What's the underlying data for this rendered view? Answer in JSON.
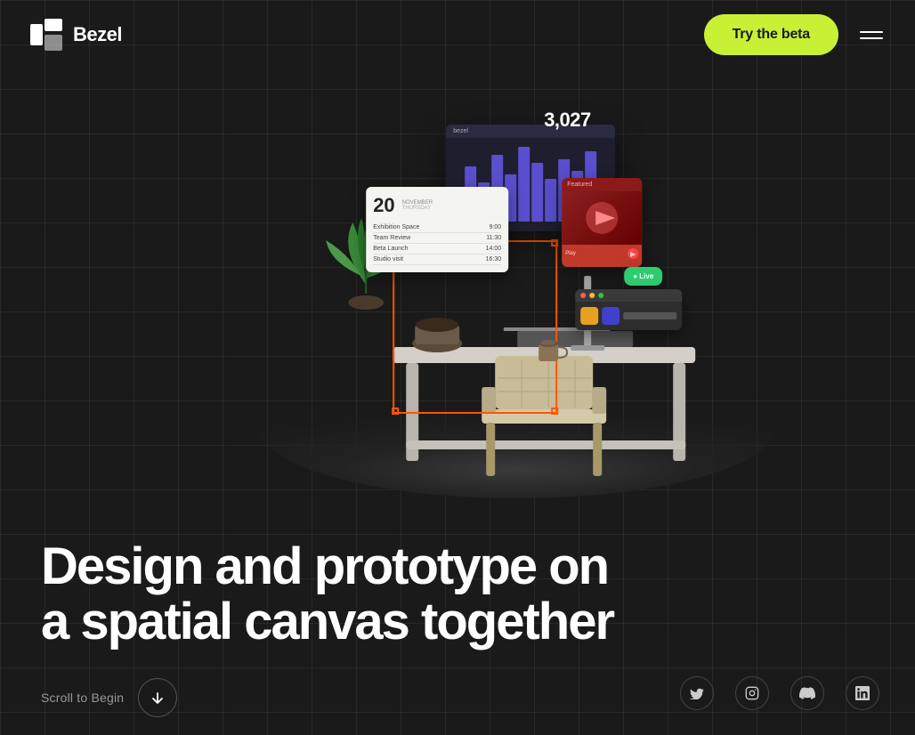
{
  "brand": {
    "name": "Bezel",
    "logo_alt": "Bezel logo"
  },
  "navbar": {
    "try_beta_label": "Try the beta",
    "menu_label": "Menu"
  },
  "hero": {
    "headline_line1": "Design and prototype on",
    "headline_line2": "a spatial canvas together"
  },
  "scroll": {
    "label": "Scroll to Begin"
  },
  "social": {
    "twitter_label": "Twitter",
    "instagram_label": "Instagram",
    "discord_label": "Discord",
    "linkedin_label": "LinkedIn"
  },
  "scene": {
    "stats_number": "3,027",
    "list_date": "20",
    "list_month": "NOVEMBER"
  },
  "colors": {
    "background": "#1a1a1a",
    "accent_green": "#c8f135",
    "accent_orange": "#ff5500",
    "text_primary": "#ffffff",
    "text_muted": "#999999"
  }
}
